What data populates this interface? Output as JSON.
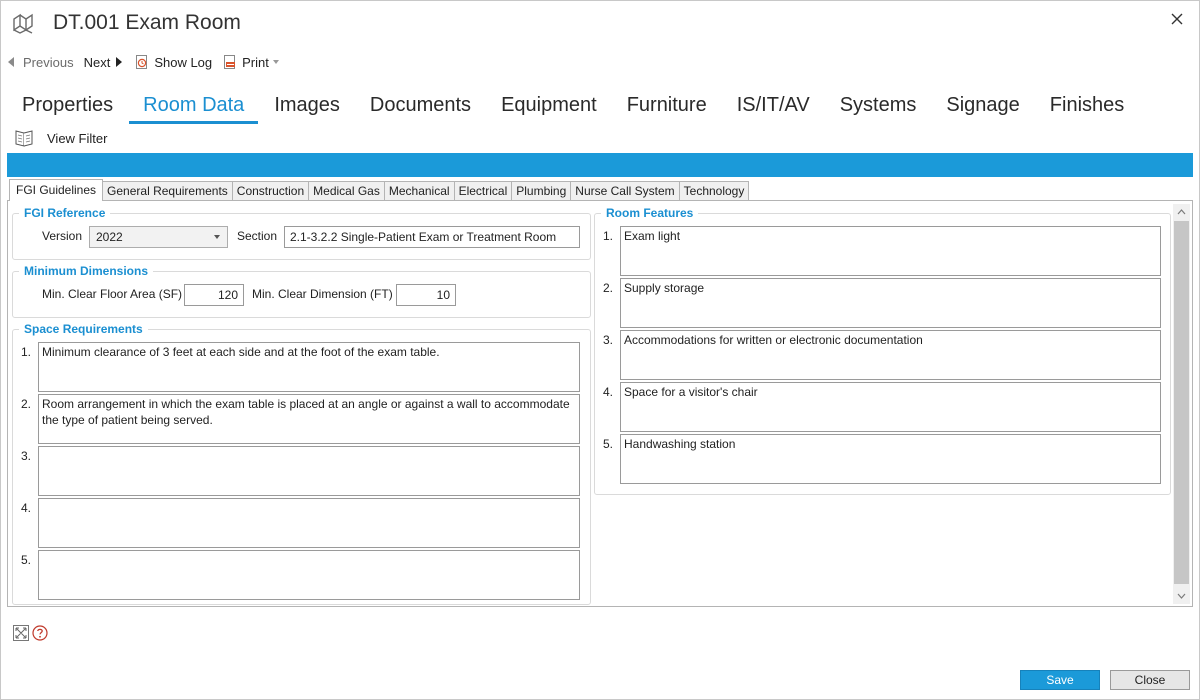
{
  "window": {
    "title": "DT.001 Exam Room"
  },
  "toolbar": {
    "previous": "Previous",
    "next": "Next",
    "show_log": "Show Log",
    "print": "Print"
  },
  "main_tabs": [
    {
      "label": "Properties",
      "active": false
    },
    {
      "label": "Room Data",
      "active": true
    },
    {
      "label": "Images",
      "active": false
    },
    {
      "label": "Documents",
      "active": false
    },
    {
      "label": "Equipment",
      "active": false
    },
    {
      "label": "Furniture",
      "active": false
    },
    {
      "label": "IS/IT/AV",
      "active": false
    },
    {
      "label": "Systems",
      "active": false
    },
    {
      "label": "Signage",
      "active": false
    },
    {
      "label": "Finishes",
      "active": false
    }
  ],
  "view_filter": "View Filter",
  "sub_tabs": [
    {
      "label": "FGI Guidelines",
      "active": true
    },
    {
      "label": "General Requirements",
      "active": false
    },
    {
      "label": "Construction",
      "active": false
    },
    {
      "label": "Medical Gas",
      "active": false
    },
    {
      "label": "Mechanical",
      "active": false
    },
    {
      "label": "Electrical",
      "active": false
    },
    {
      "label": "Plumbing",
      "active": false
    },
    {
      "label": "Nurse Call System",
      "active": false
    },
    {
      "label": "Technology",
      "active": false
    }
  ],
  "fgi_reference": {
    "title": "FGI Reference",
    "version_label": "Version",
    "version_value": "2022",
    "section_label": "Section",
    "section_value": "2.1-3.2.2 Single-Patient Exam or Treatment Room"
  },
  "min_dimensions": {
    "title": "Minimum Dimensions",
    "floor_area_label": "Min. Clear Floor Area (SF)",
    "floor_area_value": "120",
    "clear_dim_label": "Min. Clear Dimension (FT)",
    "clear_dim_value": "10"
  },
  "space_requirements": {
    "title": "Space Requirements",
    "items": [
      {
        "num": "1.",
        "text": "Minimum clearance of 3 feet at each side and at the foot of the exam table."
      },
      {
        "num": "2.",
        "text": "Room arrangement in which the exam table is placed at an angle or against a wall to accommodate the type of patient being served."
      },
      {
        "num": "3.",
        "text": ""
      },
      {
        "num": "4.",
        "text": ""
      },
      {
        "num": "5.",
        "text": ""
      }
    ]
  },
  "room_features": {
    "title": "Room Features",
    "items": [
      {
        "num": "1.",
        "text": "Exam light"
      },
      {
        "num": "2.",
        "text": "Supply storage"
      },
      {
        "num": "3.",
        "text": "Accommodations for written or electronic documentation"
      },
      {
        "num": "4.",
        "text": "Space for a visitor's chair"
      },
      {
        "num": "5.",
        "text": "Handwashing station"
      }
    ]
  },
  "footer": {
    "save": "Save",
    "close": "Close"
  },
  "colors": {
    "accent": "#1b9ad9",
    "tab_active": "#1b8fd1",
    "group_title": "#1b8fd1"
  },
  "icons": [
    "app-logo-icon",
    "close-icon",
    "previous-arrow-icon",
    "next-arrow-icon",
    "show-log-icon",
    "print-icon",
    "view-filter-icon",
    "expand-icon",
    "help-icon"
  ]
}
